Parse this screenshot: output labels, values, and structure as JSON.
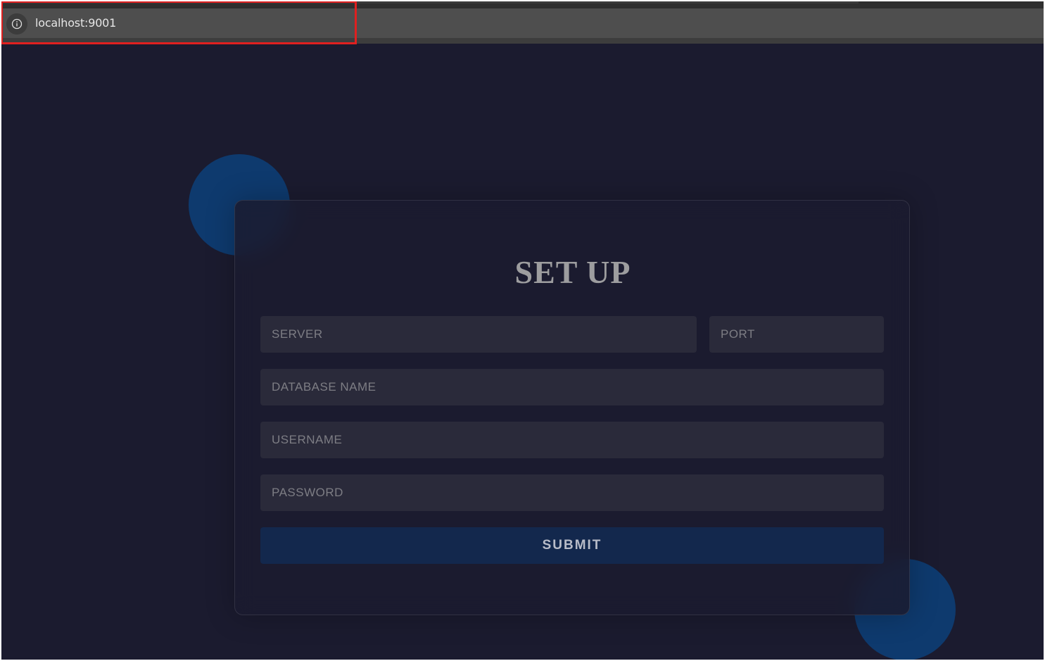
{
  "browser": {
    "url": "localhost:9001",
    "site_info_icon": "info-icon"
  },
  "form": {
    "title": "SET UP",
    "fields": {
      "server_placeholder": "SERVER",
      "port_placeholder": "PORT",
      "database_placeholder": "DATABASE NAME",
      "username_placeholder": "USERNAME",
      "password_placeholder": "PASSWORD"
    },
    "submit_label": "SUBMIT"
  },
  "colors": {
    "background": "#1b1b2f",
    "accent_circle": "#0e3a6e",
    "button": "#13284d",
    "input": "#2a2a3a",
    "highlight": "#e02020"
  }
}
